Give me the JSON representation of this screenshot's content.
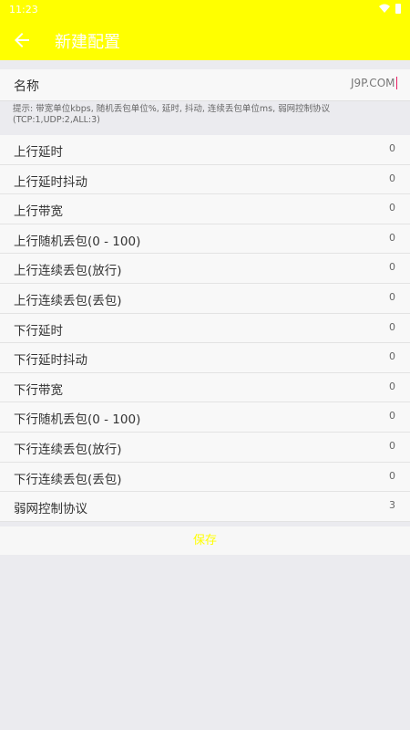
{
  "status_bar": {
    "time": "11:23"
  },
  "app_bar": {
    "title": "新建配置"
  },
  "name_field": {
    "label": "名称",
    "value": "J9P.COM"
  },
  "hint": "提示: 带宽单位kbps, 随机丢包单位%, 延时, 抖动, 连续丢包单位ms, 弱网控制协议(TCP:1,UDP:2,ALL:3)",
  "fields": [
    {
      "label": "上行延时",
      "value": "0"
    },
    {
      "label": "上行延时抖动",
      "value": "0"
    },
    {
      "label": "上行带宽",
      "value": "0"
    },
    {
      "label": "上行随机丢包(0 - 100)",
      "value": "0"
    },
    {
      "label": "上行连续丢包(放行)",
      "value": "0"
    },
    {
      "label": "上行连续丢包(丢包)",
      "value": "0"
    },
    {
      "label": "下行延时",
      "value": "0"
    },
    {
      "label": "下行延时抖动",
      "value": "0"
    },
    {
      "label": "下行带宽",
      "value": "0"
    },
    {
      "label": "下行随机丢包(0 - 100)",
      "value": "0"
    },
    {
      "label": "下行连续丢包(放行)",
      "value": "0"
    },
    {
      "label": "下行连续丢包(丢包)",
      "value": "0"
    },
    {
      "label": "弱网控制协议",
      "value": "3"
    }
  ],
  "save_button": {
    "label": "保存"
  },
  "colors": {
    "accent": "#ffff00",
    "cursor": "#e91e63",
    "background": "#ebebef"
  }
}
